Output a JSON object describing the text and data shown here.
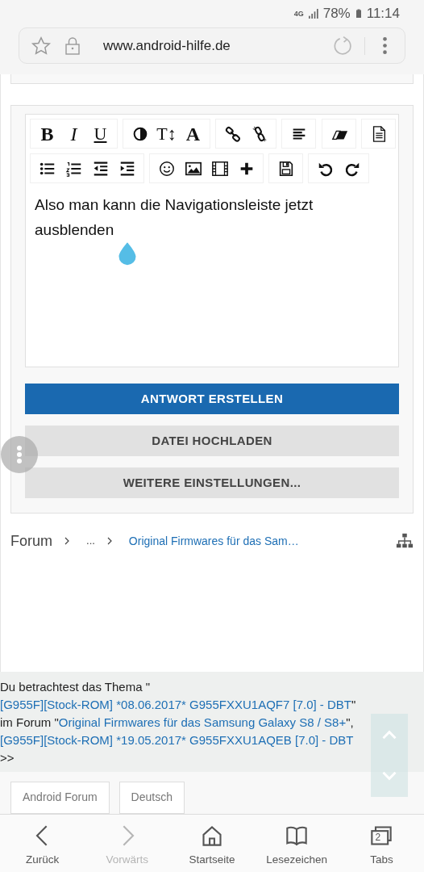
{
  "status_bar": {
    "network": "4G",
    "battery": "78%",
    "time": "11:14"
  },
  "address_bar": {
    "url": "www.android-hilfe.de"
  },
  "editor": {
    "toolbar_rows": [
      [
        [
          {
            "kind": "bold",
            "glyph": "B"
          },
          {
            "kind": "italic",
            "glyph": "I"
          },
          {
            "kind": "underline",
            "glyph": "U"
          }
        ],
        [
          {
            "kind": "contrast"
          },
          {
            "kind": "size",
            "glyph": "T↕"
          },
          {
            "kind": "font",
            "glyph": "A"
          }
        ],
        [
          {
            "kind": "link"
          },
          {
            "kind": "unlink"
          }
        ],
        [
          {
            "kind": "align"
          }
        ],
        [
          {
            "kind": "eraser"
          }
        ],
        [
          {
            "kind": "document"
          }
        ]
      ],
      [
        [
          {
            "kind": "bullets"
          },
          {
            "kind": "numbers"
          },
          {
            "kind": "outdent"
          },
          {
            "kind": "indent"
          }
        ],
        [
          {
            "kind": "smiley"
          },
          {
            "kind": "image"
          },
          {
            "kind": "film"
          },
          {
            "kind": "plus"
          }
        ],
        [
          {
            "kind": "save"
          }
        ],
        [
          {
            "kind": "undo"
          },
          {
            "kind": "redo"
          }
        ]
      ]
    ],
    "text": "Also man kann die Navigationsleiste jetzt ausblenden"
  },
  "buttons": [
    {
      "label": "ANTWORT ERSTELLEN",
      "kind": "primary"
    },
    {
      "label": "DATEI HOCHLADEN",
      "kind": "secondary"
    },
    {
      "label": "WEITERE EINSTELLUNGEN...",
      "kind": "secondary"
    }
  ],
  "breadcrumb": [
    {
      "text": "Forum",
      "kind": "text"
    },
    {
      "text": "...",
      "kind": "text"
    },
    {
      "text": "Original Firmwares für das Sam…",
      "kind": "link"
    }
  ],
  "thread_info": [
    {
      "text": "Du betrachtest das Thema \"",
      "kind": "text"
    },
    {
      "text": "[G955F][Stock-ROM] *08.06.2017* G955FXXU1AQF7 [7.0] - DBT",
      "kind": "link"
    },
    {
      "text": "\" im Forum \"",
      "kind": "text"
    },
    {
      "text": "Original Firmwares für das Samsung Galaxy S8 / S8+",
      "kind": "link"
    },
    {
      "text": "\",",
      "kind": "text"
    },
    {
      "text": "[G955F][Stock-ROM] *19.05.2017* G955FXXU1AQEB [7.0] - DBT",
      "kind": "link"
    },
    {
      "text": " >>",
      "kind": "text"
    }
  ],
  "footer_tags": [
    "Android Forum",
    "Deutsch"
  ],
  "bottom_nav": [
    {
      "kind": "back",
      "label": "Zurück",
      "disabled": false
    },
    {
      "kind": "forward",
      "label": "Vorwärts",
      "disabled": true
    },
    {
      "kind": "home",
      "label": "Startseite",
      "disabled": false
    },
    {
      "kind": "bookmarks",
      "label": "Lesezeichen",
      "disabled": false
    },
    {
      "kind": "tabs",
      "label": "Tabs",
      "disabled": false,
      "count": "2"
    }
  ]
}
